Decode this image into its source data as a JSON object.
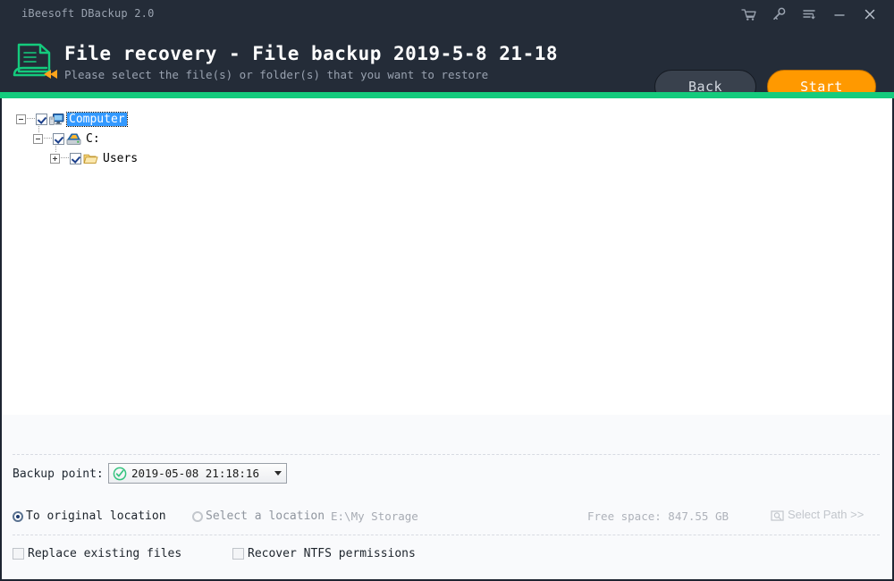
{
  "window": {
    "app_title": "iBeesoft DBackup 2.0",
    "controls": [
      {
        "name": "cart-icon",
        "label": "Shop"
      },
      {
        "name": "key-icon",
        "label": "Register"
      },
      {
        "name": "menu-icon",
        "label": "Menu"
      },
      {
        "name": "minimize-icon",
        "label": "Minimize"
      },
      {
        "name": "close-icon",
        "label": "Close"
      }
    ]
  },
  "header": {
    "logo_icon": "file-recovery-icon",
    "title": "File recovery - File backup 2019-5-8 21-18",
    "subtitle": "Please select the file(s) or folder(s) that you want to restore",
    "back_label": "Back",
    "start_label": "Start",
    "accent_green": "#14cb7d",
    "accent_orange": "#ff9900",
    "bg": "#242c38"
  },
  "tree": {
    "nodes": [
      {
        "label": "Computer",
        "icon": "computer-icon",
        "expander": "minus",
        "checked": true,
        "selected": true
      },
      {
        "label": "C:",
        "icon": "drive-icon",
        "expander": "minus",
        "checked": true,
        "selected": false
      },
      {
        "label": "Users",
        "icon": "folder-icon",
        "expander": "plus",
        "checked": true,
        "selected": false
      }
    ]
  },
  "options": {
    "backup_point_label": "Backup point:",
    "backup_point_value": "2019-05-08 21:18:16",
    "to_original_label": "To original location",
    "select_location_label": "Select a location",
    "destination_path": "E:\\My Storage",
    "free_space": "Free space: 847.55 GB",
    "select_path_label": "Select Path >>",
    "replace_label": "Replace existing files",
    "ntfs_label": "Recover NTFS permissions",
    "to_original_selected": true,
    "select_location_selected": false,
    "replace_checked": false,
    "ntfs_checked": false
  }
}
